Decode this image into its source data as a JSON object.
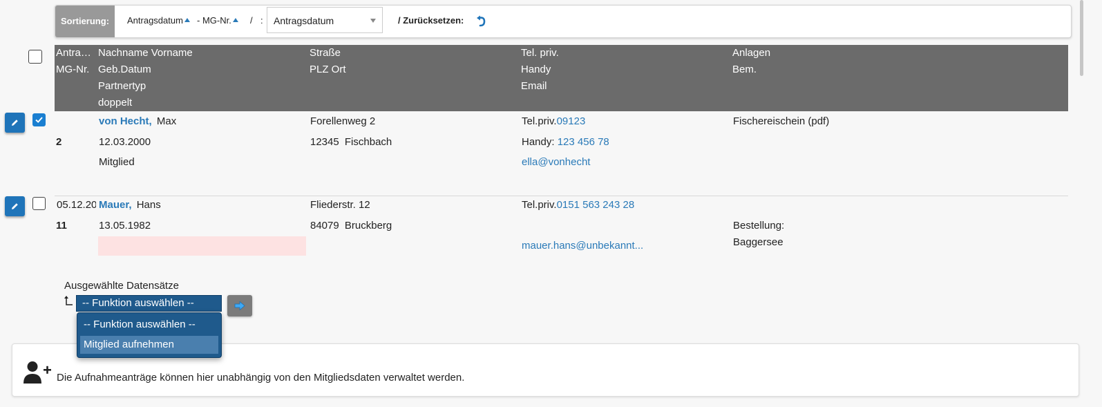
{
  "sortbar": {
    "label": "Sortierung:",
    "field1": "Antragsdatum",
    "field2": "- MG-Nr.",
    "sep1": "/",
    "sep2": ":",
    "select_value": "Antragsdatum",
    "reset_label": "/ Zurücksetzen:"
  },
  "table": {
    "headers": {
      "col1": [
        "Antra…",
        "MG-Nr."
      ],
      "col2": [
        "Nachname Vorname",
        "Geb.Datum",
        "Partnertyp",
        "doppelt"
      ],
      "col3": [
        "Straße",
        "PLZ Ort"
      ],
      "col4": [
        "Tel. priv.",
        "Handy",
        "Email"
      ],
      "col5": [
        "Anlagen",
        "Bem."
      ]
    },
    "rows": [
      {
        "checked": true,
        "date": "",
        "mg_nr": "2",
        "lastname": "von Hecht,",
        "firstname": "Max",
        "birthdate": "12.03.2000",
        "partnertype": "Mitglied",
        "street": "Forellenweg 2",
        "zip": "12345",
        "city": "Fischbach",
        "tel_label": "Tel.priv.",
        "tel": "09123",
        "handy_label": "Handy:",
        "handy": "123 456 78",
        "email": "ella@vonhecht",
        "attachment": "Fischereischein (pdf)",
        "remark1": "",
        "remark2": ""
      },
      {
        "checked": false,
        "date": "05.12.20",
        "mg_nr": "11",
        "lastname": "Mauer,",
        "firstname": "Hans",
        "birthdate": "13.05.1982",
        "partnertype": "",
        "street": "Fliederstr. 12",
        "zip": "84079",
        "city": "Bruckberg",
        "tel_label": "Tel.priv.",
        "tel": "0151 563 243 28",
        "handy_label": "",
        "handy": "",
        "email": "mauer.hans@unbekannt...",
        "attachment": "",
        "remark1": "Bestellung:",
        "remark2": "Baggersee"
      }
    ]
  },
  "bulk": {
    "label": "Ausgewählte Datensätze",
    "select_value": "-- Funktion auswählen --",
    "options": [
      "-- Funktion auswählen --",
      "Mitglied aufnehmen"
    ]
  },
  "info": {
    "text": "Die Aufnahmeanträge können hier unabhängig von den Mitgliedsdaten verwaltet werden."
  },
  "colors": {
    "accent": "#1f74b9",
    "header_bg": "#6b6b6b",
    "link": "#2a7ab8",
    "dropdown_bg": "#1f5a8c"
  }
}
